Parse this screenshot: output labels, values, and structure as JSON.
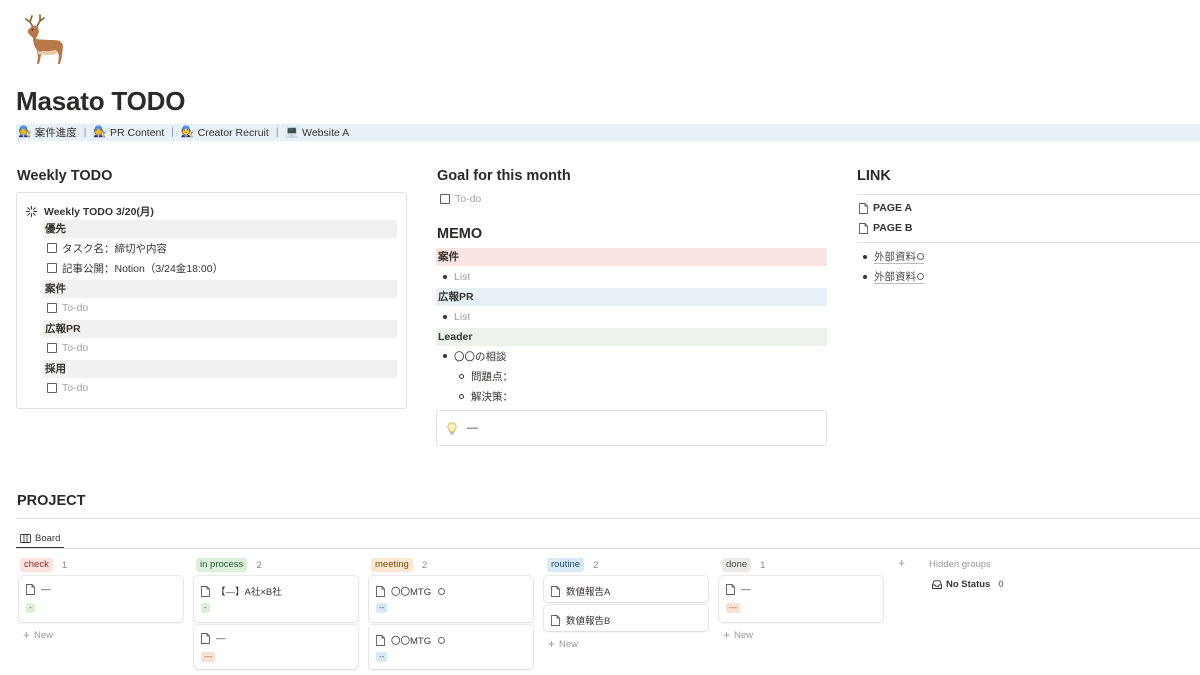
{
  "page": {
    "icon": "deer-icon",
    "title": "Masato TODO"
  },
  "nav": {
    "items": [
      {
        "icon": "worker-emoji",
        "label": "案件進度"
      },
      {
        "icon": "worker-emoji",
        "label": "PR Content"
      },
      {
        "icon": "worker-emoji",
        "label": "Creator Recruit"
      },
      {
        "icon": "computer-emoji",
        "label": "Website A"
      }
    ],
    "separator": "|"
  },
  "weekly": {
    "title": "Weekly TODO",
    "header": "Weekly TODO 3/20(月)",
    "categories": [
      {
        "label": "優先",
        "todos": [
          "タスク名：締切や内容",
          "記事公開：Notion（3/24金18:00）"
        ]
      },
      {
        "label": "案件",
        "todos": [
          "To-do"
        ]
      },
      {
        "label": "広報PR",
        "todos": [
          "To-do"
        ]
      },
      {
        "label": "採用",
        "todos": [
          "To-do"
        ]
      }
    ]
  },
  "goal": {
    "title": "Goal for this month",
    "todo": "To-do"
  },
  "memo": {
    "title": "MEMO",
    "sections": [
      {
        "label": "案件",
        "color": "#fbe4e4",
        "item": "List"
      },
      {
        "label": "広報PR",
        "color": "#e7f0f7",
        "item": "List"
      },
      {
        "label": "Leader",
        "color": "#edf3ec"
      }
    ],
    "leader": {
      "item": "〇〇の相談",
      "sub": [
        "問題点：",
        "解決策："
      ]
    },
    "callout": {
      "icon": "lightbulb-icon",
      "text": "—"
    }
  },
  "link": {
    "title": "LINK",
    "pages": [
      "PAGE A",
      "PAGE B"
    ],
    "external": [
      "外部資料",
      "外部資料"
    ]
  },
  "project": {
    "title": "PROJECT",
    "view_tab": "Board",
    "new_label": "New",
    "hidden_groups": "Hidden groups",
    "no_status": "No Status",
    "no_status_count": "0",
    "columns": [
      {
        "label": "check",
        "count": "1",
        "bg": "#fde2e0",
        "fg": "#8f2c23",
        "cards": [
          {
            "title": "—",
            "tag": "-",
            "tag_bg": "#dcefdc",
            "tag_fg": "#2b6b35"
          }
        ]
      },
      {
        "label": "in process",
        "count": "2",
        "bg": "#dcefdc",
        "fg": "#1f5f2c",
        "cards": [
          {
            "title": "【—】A社×B社",
            "tag": "-",
            "tag_bg": "#dcefdc",
            "tag_fg": "#2b6b35"
          },
          {
            "title": "—",
            "tag": "---",
            "tag_bg": "#fbe1d2",
            "tag_fg": "#a14e1b"
          }
        ]
      },
      {
        "label": "meeting",
        "count": "2",
        "bg": "#fbe7cf",
        "fg": "#7a4a11",
        "cards": [
          {
            "title": "〇〇MTG",
            "tag": "--",
            "tag_bg": "#d9e9f6",
            "tag_fg": "#2a5a86"
          },
          {
            "title": "〇〇MTG",
            "tag": "--",
            "tag_bg": "#d9e9f6",
            "tag_fg": "#2a5a86"
          }
        ]
      },
      {
        "label": "routine",
        "count": "2",
        "bg": "#d9e9f6",
        "fg": "#1f4f7a",
        "cards": [
          {
            "title": "数値報告A"
          },
          {
            "title": "数値報告B"
          }
        ]
      },
      {
        "label": "done",
        "count": "1",
        "bg": "#ebeae7",
        "fg": "#4a4944",
        "cards": [
          {
            "title": "—",
            "tag": "---",
            "tag_bg": "#fbe1d2",
            "tag_fg": "#a14e1b"
          }
        ]
      }
    ]
  }
}
